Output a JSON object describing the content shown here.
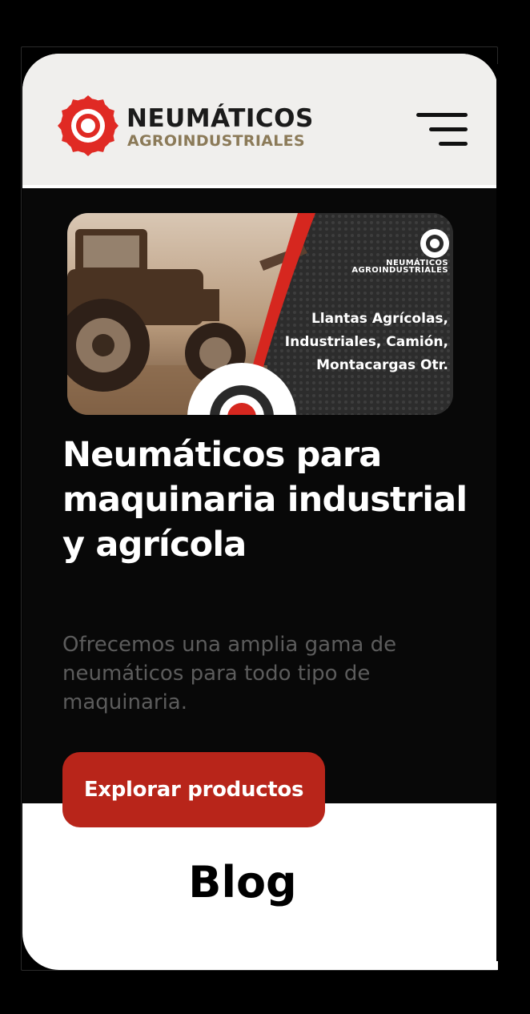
{
  "header": {
    "brand_name": "NEUMÁTICOS",
    "brand_sub": "AGROINDUSTRIALES",
    "logo_icon": "tire-logo-icon",
    "menu_icon": "hamburger-menu-icon"
  },
  "banner": {
    "logo_line1": "NEUMÁTICOS",
    "logo_line2": "AGROINDUSTRIALES",
    "lines": [
      "Llantas Agrícolas,",
      "Industriales, Camión,",
      "Montacargas Otr."
    ]
  },
  "hero": {
    "title": "Neumáticos para maquinaria industrial y agrícola",
    "description": "Ofrecemos una amplia gama de neumáticos para todo tipo de maquinaria.",
    "cta_label": "Explorar productos"
  },
  "blog": {
    "title": "Blog"
  },
  "colors": {
    "accent": "#b8251a",
    "brand_red": "#e02a24",
    "brand_gold": "#8b7a58",
    "hero_bg": "#080808",
    "header_bg": "#f0efed"
  }
}
